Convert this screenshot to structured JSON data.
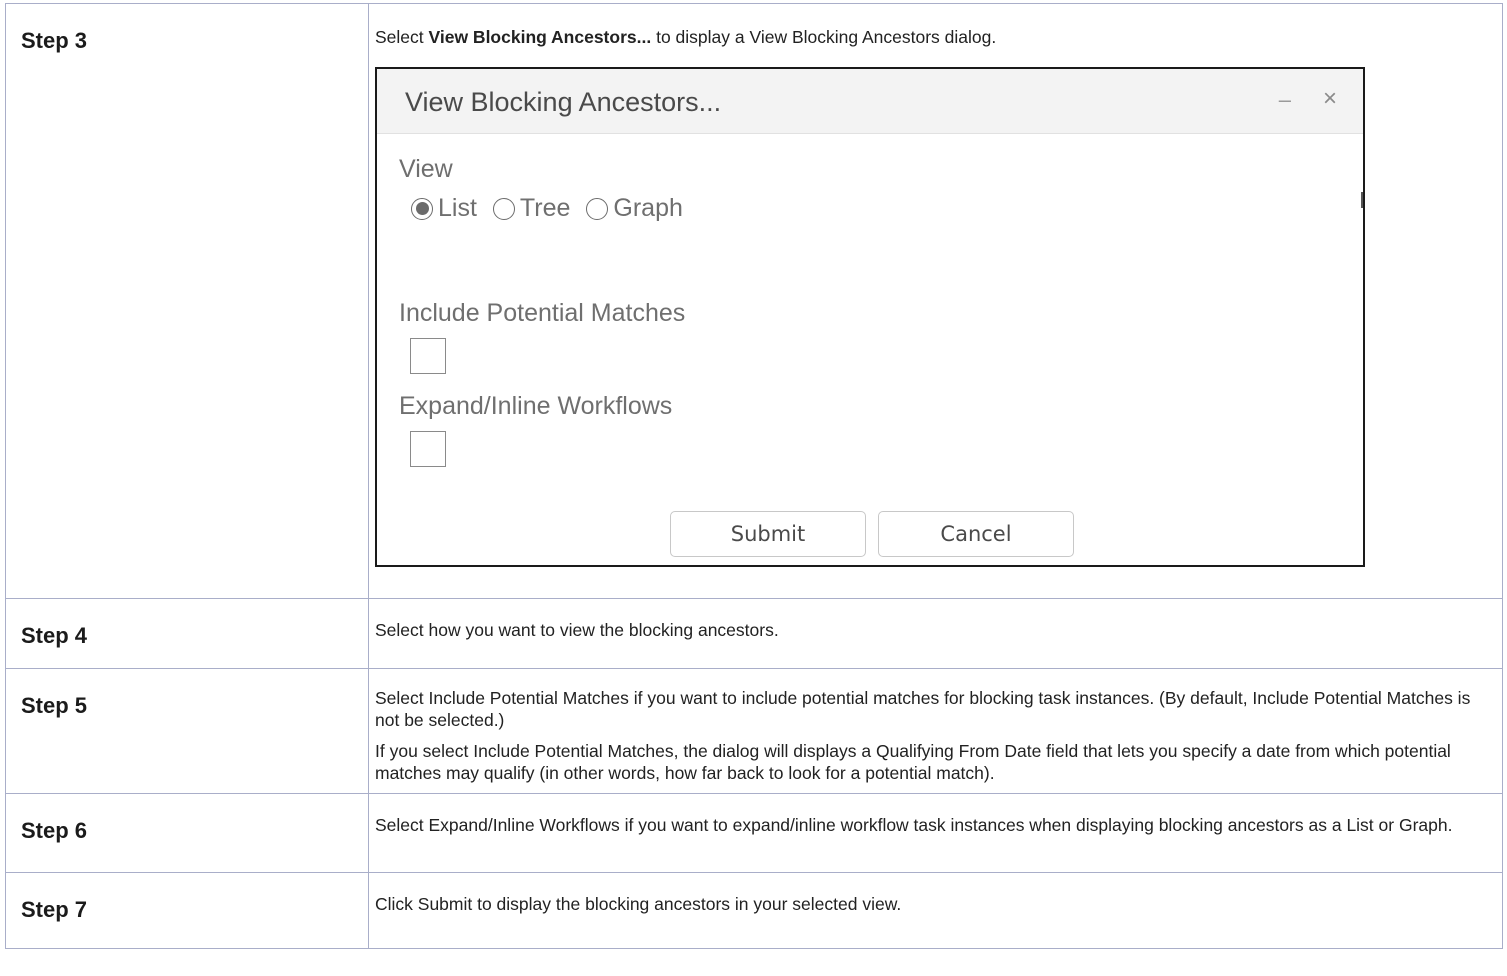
{
  "rows": [
    {
      "step": "Step 3",
      "text_prefix": "Select ",
      "text_bold": "View Blocking Ancestors...",
      "text_suffix": " to display a View Blocking Ancestors dialog."
    },
    {
      "step": "Step 4",
      "paragraphs": [
        "Select how you want to view the blocking ancestors."
      ]
    },
    {
      "step": "Step 5",
      "paragraphs": [
        "Select Include Potential Matches if you want to include potential matches for blocking task instances. (By default, Include Potential Matches is not be selected.)",
        "If you select Include Potential Matches, the dialog will displays a Qualifying From Date field that lets you specify a date from which potential matches may qualify (in other words, how far back to look for a potential match)."
      ]
    },
    {
      "step": "Step 6",
      "paragraphs": [
        "Select Expand/Inline Workflows if you want to expand/inline workflow task instances when displaying blocking ancestors as a List or Graph."
      ]
    },
    {
      "step": "Step 7",
      "paragraphs": [
        "Click Submit to display the blocking ancestors in your selected view."
      ]
    }
  ],
  "dialog": {
    "title": "View Blocking Ancestors...",
    "minimize_symbol": "–",
    "close_symbol": "×",
    "view_label": "View",
    "view_options": [
      "List",
      "Tree",
      "Graph"
    ],
    "view_selected": "List",
    "include_potential_label": "Include Potential Matches",
    "include_potential_checked": false,
    "expand_label": "Expand/Inline Workflows",
    "expand_checked": false,
    "submit_label": "Submit",
    "cancel_label": "Cancel"
  }
}
